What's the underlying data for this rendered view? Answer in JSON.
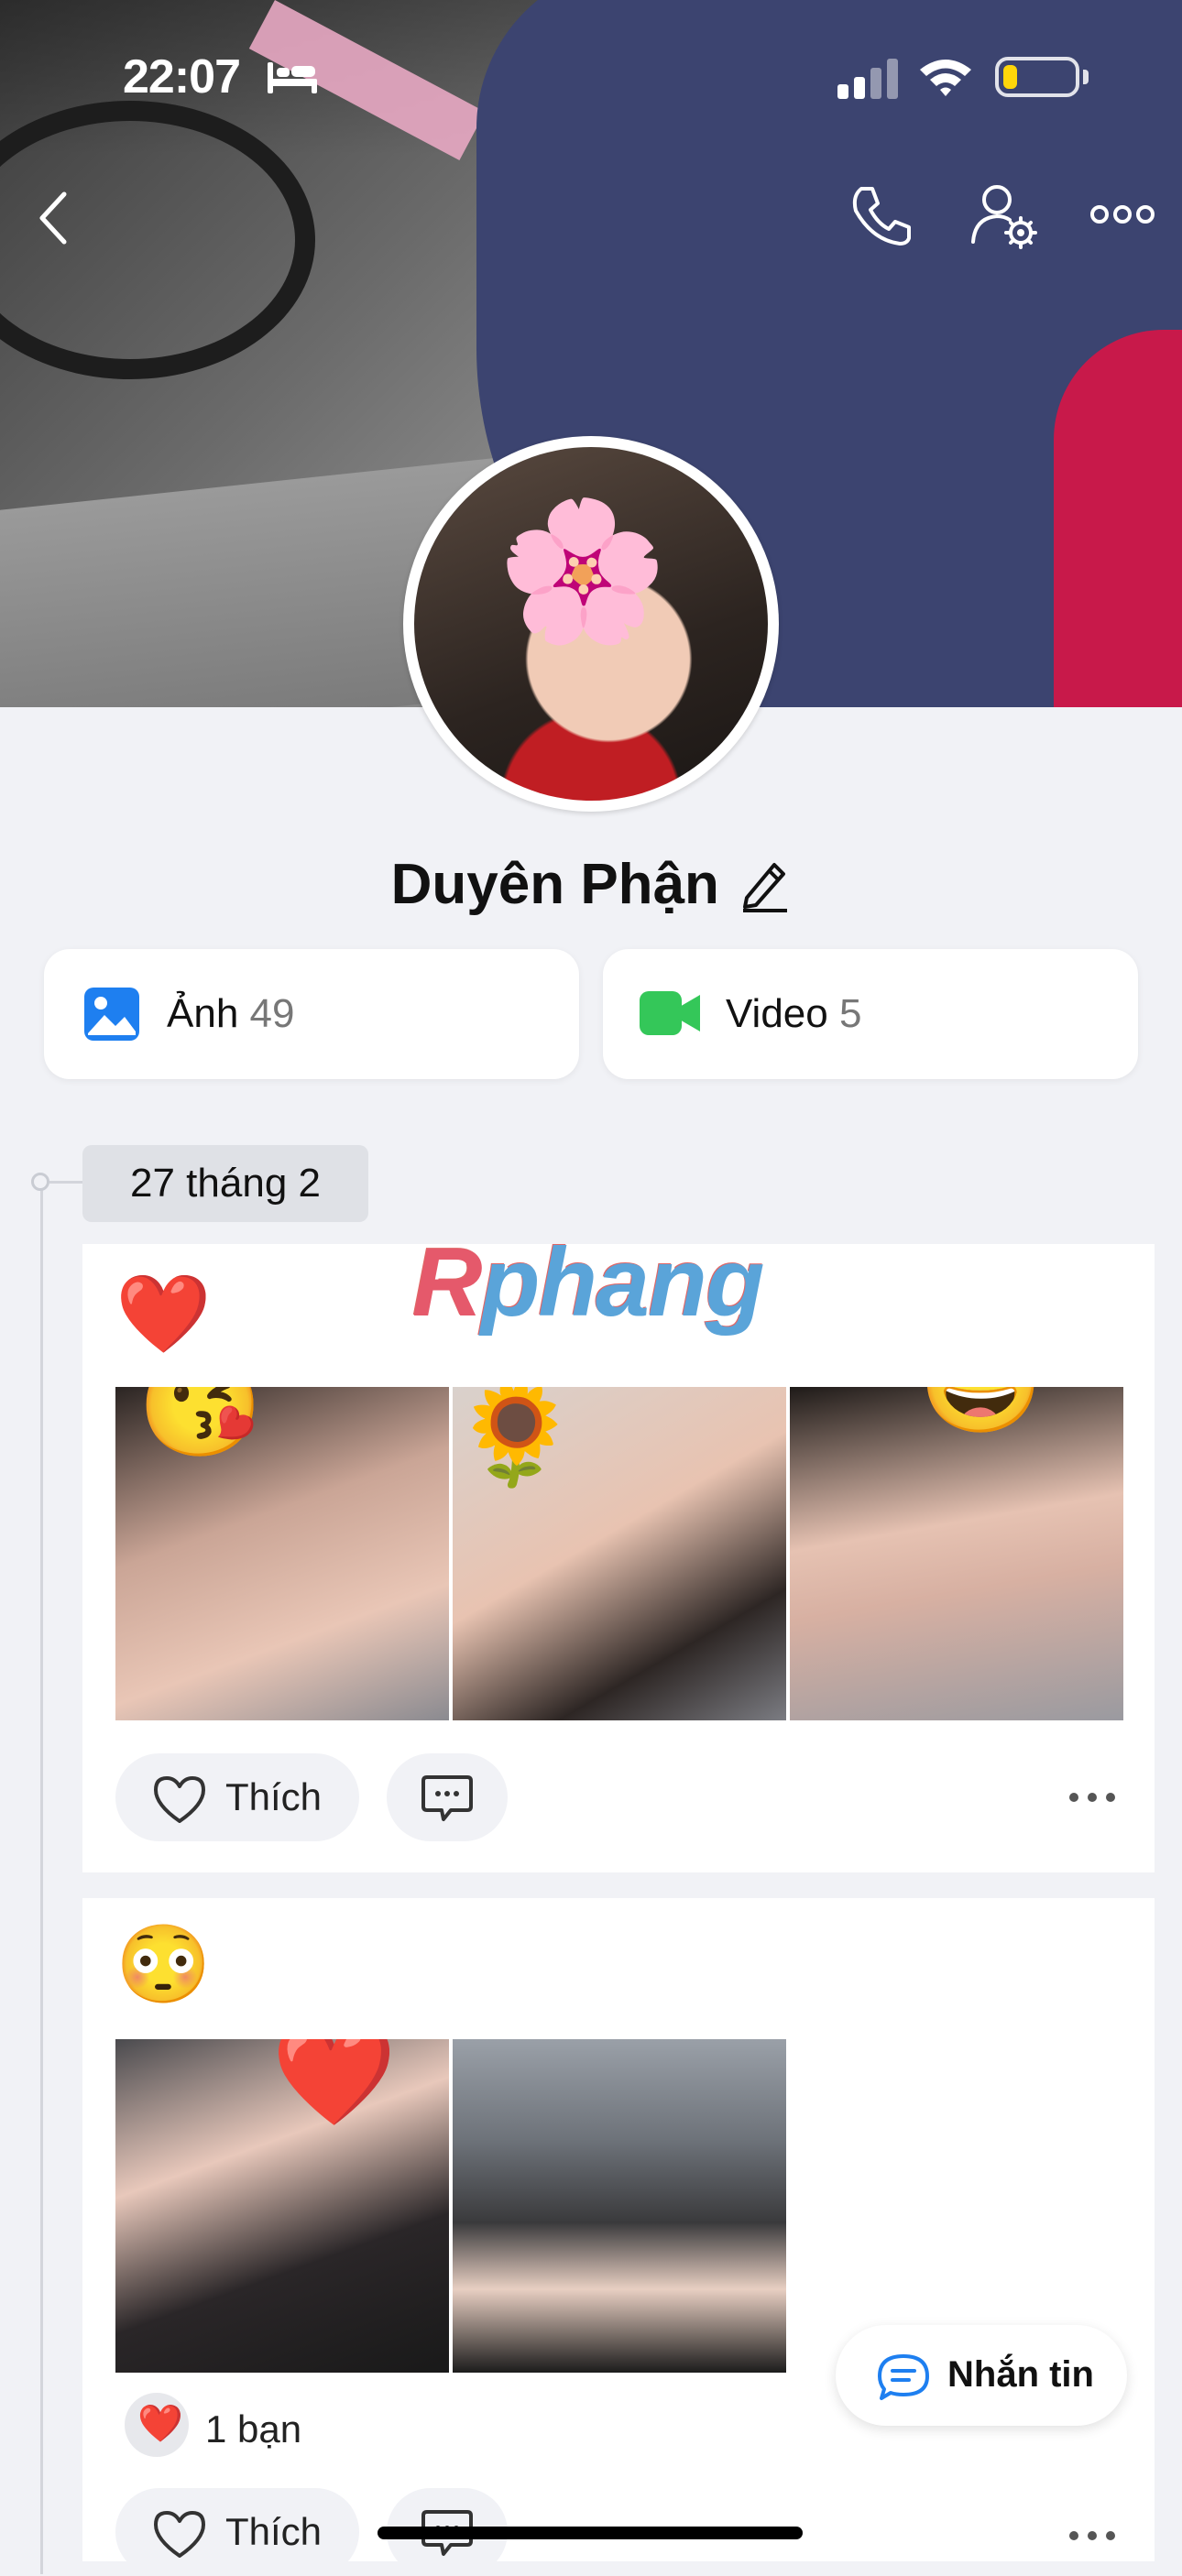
{
  "status_bar": {
    "time": "22:07",
    "sleep_icon": "bed-icon",
    "signal_icon": "cellular-signal-icon",
    "wifi_icon": "wifi-icon",
    "battery_level": 0.2,
    "battery_color": "#ffd60a"
  },
  "header": {
    "back_icon": "chevron-left-icon",
    "call_icon": "phone-icon",
    "settings_icon": "user-gear-icon",
    "more_icon": "ellipsis-icon"
  },
  "profile": {
    "name": "Duyên Phận",
    "edit_icon": "pencil-icon"
  },
  "media": [
    {
      "label": "Ảnh",
      "count": "49",
      "icon": "photo-icon",
      "color": "#1e7ff0"
    },
    {
      "label": "Video",
      "count": "5",
      "icon": "video-camera-icon",
      "color": "#34c759"
    }
  ],
  "timeline": {
    "date": "27 tháng 2"
  },
  "watermark": {
    "first": "R",
    "rest": "phang"
  },
  "posts": [
    {
      "emoji": "❤️",
      "photos": [
        "😘",
        "🌻",
        "😄"
      ],
      "like_label": "Thích",
      "comment_icon": "comment-icon",
      "more_icon": "ellipsis-icon"
    },
    {
      "emoji": "😳",
      "photos": [
        "❤️",
        ""
      ],
      "reaction_heart": "❤️",
      "reaction_text": "1 bạn",
      "like_label": "Thích",
      "comment_icon": "comment-icon",
      "more_icon": "ellipsis-icon"
    }
  ],
  "message_button": {
    "label": "Nhắn tin",
    "icon": "chat-bubble-icon"
  },
  "colors": {
    "accent": "#1e7ff0",
    "background": "#f1f2f6"
  }
}
